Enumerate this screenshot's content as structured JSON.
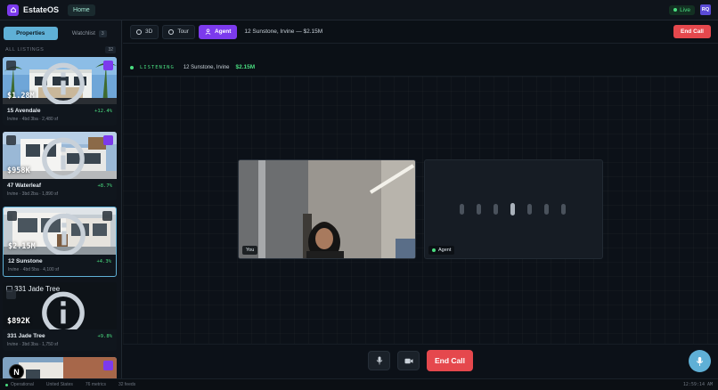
{
  "app": {
    "brand": "EstateOS",
    "home_label": "Home",
    "live_label": "Live",
    "user_initials": "RQ"
  },
  "sidebar": {
    "tabs": [
      {
        "label": "Properties"
      },
      {
        "label": "Watchlist",
        "count": "3"
      }
    ],
    "list_title": "ALL LISTINGS",
    "list_count": "32",
    "cards": [
      {
        "price": "$1.28M",
        "name": "15 Avendale",
        "change": "+12.4%",
        "meta": "Irvine · 4bd 3ba · 2,480 sf",
        "bookmarked": true
      },
      {
        "price": "$958K",
        "name": "47 Waterleaf",
        "change": "+8.7%",
        "meta": "Irvine · 3bd 2ba · 1,890 sf",
        "bookmarked": true
      },
      {
        "price": "$2.15M",
        "name": "12 Sunstone",
        "change": "+4.3%",
        "meta": "Irvine · 4bd 5ba · 4,100 sf",
        "bookmarked": false
      },
      {
        "price": "$892K",
        "name": "331 Jade Tree",
        "change": "+9.8%",
        "meta": "Irvine · 3bd 3ba · 1,750 sf",
        "bookmarked": false,
        "image_alt": "331 Jade Tree"
      },
      {
        "bookmarked": true
      }
    ]
  },
  "toolbar": {
    "modes": [
      {
        "label": "3D"
      },
      {
        "label": "Tour"
      },
      {
        "label": "Agent"
      }
    ],
    "context": "12 Sunstone, Irvine — $2.15M",
    "end_call_label": "End Call"
  },
  "status": {
    "state": "LISTENING",
    "address": "12 Sunstone, Irvine",
    "price": "$2.15M"
  },
  "call": {
    "you_label": "You",
    "agent_label": "Agent",
    "end_call_label": "End Call",
    "voice_level_bars": 7,
    "active_bar_index": 3
  },
  "footer": {
    "status": "Operational",
    "region": "United States",
    "metrics": "76 metrics",
    "feeds": "32 feeds",
    "clock": "12:59:14 AM"
  },
  "badge": {
    "letter": "N"
  },
  "colors": {
    "accent_purple": "#7c3aed",
    "accent_teal": "#5fb0d6",
    "danger": "#e5484d",
    "success": "#4ade80"
  }
}
